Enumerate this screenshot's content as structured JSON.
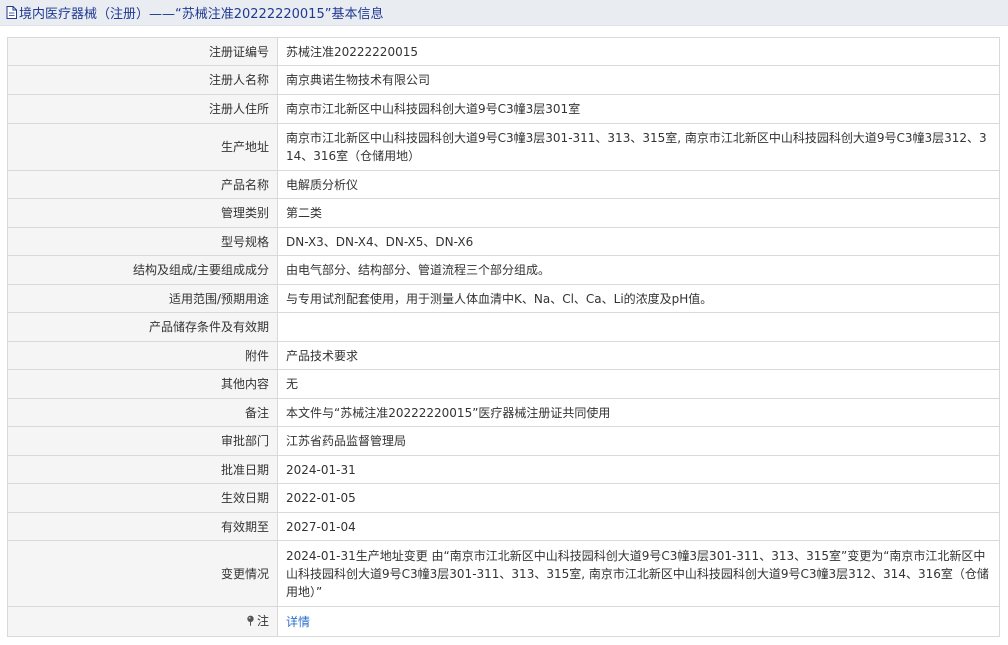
{
  "header": {
    "title": "境内医疗器械（注册）——“苏械注准20222220015”基本信息",
    "icon": "document-icon"
  },
  "rows": [
    {
      "label": "注册证编号",
      "value": "苏械注准20222220015"
    },
    {
      "label": "注册人名称",
      "value": "南京典诺生物技术有限公司"
    },
    {
      "label": "注册人住所",
      "value": "南京市江北新区中山科技园科创大道9号C3幢3层301室"
    },
    {
      "label": "生产地址",
      "value": "南京市江北新区中山科技园科创大道9号C3幢3层301-311、313、315室, 南京市江北新区中山科技园科创大道9号C3幢3层312、314、316室（仓储用地）"
    },
    {
      "label": "产品名称",
      "value": "电解质分析仪"
    },
    {
      "label": "管理类别",
      "value": "第二类"
    },
    {
      "label": "型号规格",
      "value": "DN-X3、DN-X4、DN-X5、DN-X6"
    },
    {
      "label": "结构及组成/主要组成成分",
      "value": "由电气部分、结构部分、管道流程三个部分组成。"
    },
    {
      "label": "适用范围/预期用途",
      "value": "与专用试剂配套使用，用于测量人体血清中K、Na、Cl、Ca、Li的浓度及pH值。"
    },
    {
      "label": "产品储存条件及有效期",
      "value": ""
    },
    {
      "label": "附件",
      "value": "产品技术要求"
    },
    {
      "label": "其他内容",
      "value": "无"
    },
    {
      "label": "备注",
      "value": "本文件与“苏械注准20222220015”医疗器械注册证共同使用"
    },
    {
      "label": "审批部门",
      "value": "江苏省药品监督管理局"
    },
    {
      "label": "批准日期",
      "value": "2024-01-31"
    },
    {
      "label": "生效日期",
      "value": "2022-01-05"
    },
    {
      "label": "有效期至",
      "value": "2027-01-04"
    },
    {
      "label": "变更情况",
      "value": "2024-01-31生产地址变更 由“南京市江北新区中山科技园科创大道9号C3幢3层301-311、313、315室”变更为“南京市江北新区中山科技园科创大道9号C3幢3层301-311、313、315室, 南京市江北新区中山科技园科创大道9号C3幢3层312、314、316室（仓储用地）”"
    }
  ],
  "note": {
    "label": "注",
    "link_text": "详情",
    "icon": "pin-icon"
  },
  "colors": {
    "title_text": "#1f3a93",
    "title_bg": "#e9ecf1",
    "label_bg": "#f5f5f5",
    "border": "#d9d9d9",
    "link": "#2a6fc9"
  }
}
